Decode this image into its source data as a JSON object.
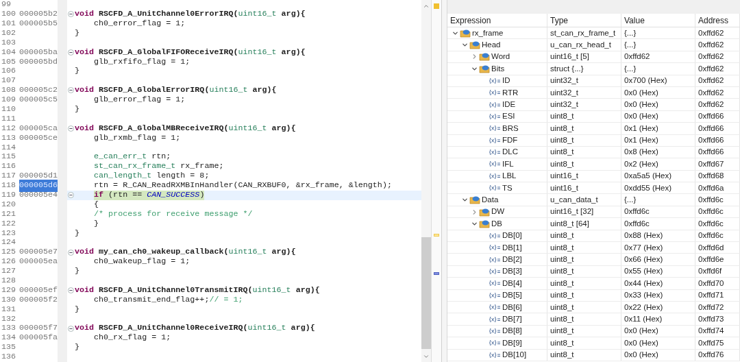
{
  "editor": {
    "lines": [
      {
        "number": "99",
        "fold": false,
        "current": false
      },
      {
        "number": "100",
        "address": "000005b2",
        "fold": true,
        "current": false,
        "address_selected": false,
        "tokens": [
          {
            "kind": "keyword",
            "text": "void"
          },
          {
            "kind": "decl",
            "text": " RSCFD_A_UnitChannel0ErrorIRQ("
          },
          {
            "kind": "type",
            "text": "uint16_t"
          },
          {
            "kind": "decl",
            "text": " arg){"
          }
        ]
      },
      {
        "number": "101",
        "address": "000005b5",
        "fold": false,
        "current": false,
        "address_selected": false,
        "tokens": [
          {
            "kind": "plain",
            "text": "    ch0_error_flag = 1;"
          }
        ]
      },
      {
        "number": "102",
        "fold": false,
        "current": false,
        "tokens": [
          {
            "kind": "plain",
            "text": "}"
          }
        ]
      },
      {
        "number": "103",
        "fold": false,
        "current": false
      },
      {
        "number": "104",
        "address": "000005ba",
        "fold": true,
        "current": false,
        "address_selected": false,
        "tokens": [
          {
            "kind": "keyword",
            "text": "void"
          },
          {
            "kind": "decl",
            "text": " RSCFD_A_GlobalFIFOReceiveIRQ("
          },
          {
            "kind": "type",
            "text": "uint16_t"
          },
          {
            "kind": "decl",
            "text": " arg){"
          }
        ]
      },
      {
        "number": "105",
        "address": "000005bd",
        "fold": false,
        "current": false,
        "address_selected": false,
        "tokens": [
          {
            "kind": "plain",
            "text": "    glb_rxfifo_flag = 1;"
          }
        ]
      },
      {
        "number": "106",
        "fold": false,
        "current": false,
        "tokens": [
          {
            "kind": "plain",
            "text": "}"
          }
        ]
      },
      {
        "number": "107",
        "fold": false,
        "current": false
      },
      {
        "number": "108",
        "address": "000005c2",
        "fold": true,
        "current": false,
        "address_selected": false,
        "tokens": [
          {
            "kind": "keyword",
            "text": "void"
          },
          {
            "kind": "decl",
            "text": " RSCFD_A_GlobalErrorIRQ("
          },
          {
            "kind": "type",
            "text": "uint16_t"
          },
          {
            "kind": "decl",
            "text": " arg){"
          }
        ]
      },
      {
        "number": "109",
        "address": "000005c5",
        "fold": false,
        "current": false,
        "address_selected": false,
        "tokens": [
          {
            "kind": "plain",
            "text": "    glb_error_flag = 1;"
          }
        ]
      },
      {
        "number": "110",
        "fold": false,
        "current": false,
        "tokens": [
          {
            "kind": "plain",
            "text": "}"
          }
        ]
      },
      {
        "number": "111",
        "fold": false,
        "current": false
      },
      {
        "number": "112",
        "address": "000005ca",
        "fold": true,
        "current": false,
        "address_selected": false,
        "tokens": [
          {
            "kind": "keyword",
            "text": "void"
          },
          {
            "kind": "decl",
            "text": " RSCFD_A_GlobalMBReceiveIRQ("
          },
          {
            "kind": "type",
            "text": "uint16_t"
          },
          {
            "kind": "decl",
            "text": " arg){"
          }
        ]
      },
      {
        "number": "113",
        "address": "000005ce",
        "fold": false,
        "current": false,
        "address_selected": false,
        "tokens": [
          {
            "kind": "plain",
            "text": "    glb_rxmb_flag = 1;"
          }
        ]
      },
      {
        "number": "114",
        "fold": false,
        "current": false
      },
      {
        "number": "115",
        "fold": false,
        "current": false,
        "tokens": [
          {
            "kind": "type",
            "text": "    e_can_err_t"
          },
          {
            "kind": "plain",
            "text": " rtn;"
          }
        ]
      },
      {
        "number": "116",
        "fold": false,
        "current": false,
        "tokens": [
          {
            "kind": "type",
            "text": "    st_can_rx_frame_t"
          },
          {
            "kind": "plain",
            "text": " rx_frame;"
          }
        ]
      },
      {
        "number": "117",
        "address": "000005d1",
        "fold": false,
        "current": false,
        "address_selected": false,
        "tokens": [
          {
            "kind": "type",
            "text": "    can_length_t"
          },
          {
            "kind": "plain",
            "text": " length = 8;"
          }
        ]
      },
      {
        "number": "118",
        "address": "000005d6",
        "fold": false,
        "current": false,
        "address_selected": true,
        "tokens": [
          {
            "kind": "plain",
            "text": "    rtn = R_CAN_ReadRXMBInHandler(CAN_RXBUF0, &rx_frame, &length);"
          }
        ]
      },
      {
        "number": "119",
        "address": "000005e4",
        "fold": true,
        "current": true,
        "address_selected": false,
        "tokens": [
          {
            "kind": "keyword",
            "text": "    if"
          },
          {
            "kind": "plain",
            "text": " (rtn == "
          },
          {
            "kind": "constant",
            "text": "CAN_SUCCESS"
          },
          {
            "kind": "plain",
            "text": ")"
          }
        ]
      },
      {
        "number": "120",
        "fold": false,
        "current": false,
        "tokens": [
          {
            "kind": "plain",
            "text": "    {"
          }
        ]
      },
      {
        "number": "121",
        "fold": false,
        "current": false,
        "tokens": [
          {
            "kind": "comment",
            "text": "    /* process for receive message */"
          }
        ]
      },
      {
        "number": "122",
        "fold": false,
        "current": false,
        "tokens": [
          {
            "kind": "plain",
            "text": "    }"
          }
        ]
      },
      {
        "number": "123",
        "fold": false,
        "current": false,
        "tokens": [
          {
            "kind": "plain",
            "text": "}"
          }
        ]
      },
      {
        "number": "124",
        "fold": false,
        "current": false
      },
      {
        "number": "125",
        "address": "000005e7",
        "fold": true,
        "current": false,
        "address_selected": false,
        "tokens": [
          {
            "kind": "keyword",
            "text": "void"
          },
          {
            "kind": "decl",
            "text": " my_can_ch0_wakeup_callback("
          },
          {
            "kind": "type",
            "text": "uint16_t"
          },
          {
            "kind": "decl",
            "text": " arg){"
          }
        ]
      },
      {
        "number": "126",
        "address": "000005ea",
        "fold": false,
        "current": false,
        "address_selected": false,
        "tokens": [
          {
            "kind": "plain",
            "text": "    ch0_wakeup_flag = 1;"
          }
        ]
      },
      {
        "number": "127",
        "fold": false,
        "current": false,
        "tokens": [
          {
            "kind": "plain",
            "text": "}"
          }
        ]
      },
      {
        "number": "128",
        "fold": false,
        "current": false
      },
      {
        "number": "129",
        "address": "000005ef",
        "fold": true,
        "current": false,
        "address_selected": false,
        "tokens": [
          {
            "kind": "keyword",
            "text": "void"
          },
          {
            "kind": "decl",
            "text": " RSCFD_A_UnitChannel0TransmitIRQ("
          },
          {
            "kind": "type",
            "text": "uint16_t"
          },
          {
            "kind": "decl",
            "text": " arg){"
          }
        ]
      },
      {
        "number": "130",
        "address": "000005f2",
        "fold": false,
        "current": false,
        "address_selected": false,
        "tokens": [
          {
            "kind": "plain",
            "text": "    ch0_transmit_end_flag++;"
          },
          {
            "kind": "comment",
            "text": "// = 1;"
          }
        ]
      },
      {
        "number": "131",
        "fold": false,
        "current": false,
        "tokens": [
          {
            "kind": "plain",
            "text": "}"
          }
        ]
      },
      {
        "number": "132",
        "fold": false,
        "current": false
      },
      {
        "number": "133",
        "address": "000005f7",
        "fold": true,
        "current": false,
        "address_selected": false,
        "tokens": [
          {
            "kind": "keyword",
            "text": "void"
          },
          {
            "kind": "decl",
            "text": " RSCFD_A_UnitChannel0ReceiveIRQ("
          },
          {
            "kind": "type",
            "text": "uint16_t"
          },
          {
            "kind": "decl",
            "text": " arg){"
          }
        ]
      },
      {
        "number": "134",
        "address": "000005fa",
        "fold": false,
        "current": false,
        "address_selected": false,
        "tokens": [
          {
            "kind": "plain",
            "text": "    ch0_rx_flag = 1;"
          }
        ]
      },
      {
        "number": "135",
        "fold": false,
        "current": false,
        "tokens": [
          {
            "kind": "plain",
            "text": "}"
          }
        ]
      },
      {
        "number": "136",
        "fold": false,
        "current": false
      }
    ]
  },
  "watch": {
    "columns": [
      "Expression",
      "Type",
      "Value",
      "Address"
    ],
    "rows": [
      {
        "kind": "struct",
        "expanded": true,
        "name": "rx_frame",
        "type": "st_can_rx_frame_t",
        "value": "{...}",
        "address": "0xffd62",
        "children": [
          {
            "kind": "struct",
            "expanded": true,
            "name": "Head",
            "type": "u_can_rx_head_t",
            "value": "{...}",
            "address": "0xffd62",
            "children": [
              {
                "kind": "struct",
                "expanded": false,
                "name": "Word",
                "type": "uint16_t [5]",
                "value": "0xffd62",
                "address": "0xffd62"
              },
              {
                "kind": "struct",
                "expanded": true,
                "name": "Bits",
                "type": "struct {...}",
                "value": "{...}",
                "address": "0xffd62",
                "children": [
                  {
                    "kind": "variable",
                    "name": "ID",
                    "type": "uint32_t",
                    "value": "0x700 (Hex)",
                    "address": "0xffd62"
                  },
                  {
                    "kind": "variable",
                    "name": "RTR",
                    "type": "uint32_t",
                    "value": "0x0 (Hex)",
                    "address": "0xffd62"
                  },
                  {
                    "kind": "variable",
                    "name": "IDE",
                    "type": "uint32_t",
                    "value": "0x0 (Hex)",
                    "address": "0xffd62"
                  },
                  {
                    "kind": "variable",
                    "name": "ESI",
                    "type": "uint8_t",
                    "value": "0x0 (Hex)",
                    "address": "0xffd66"
                  },
                  {
                    "kind": "variable",
                    "name": "BRS",
                    "type": "uint8_t",
                    "value": "0x1 (Hex)",
                    "address": "0xffd66"
                  },
                  {
                    "kind": "variable",
                    "name": "FDF",
                    "type": "uint8_t",
                    "value": "0x1 (Hex)",
                    "address": "0xffd66"
                  },
                  {
                    "kind": "variable",
                    "name": "DLC",
                    "type": "uint8_t",
                    "value": "0x8 (Hex)",
                    "address": "0xffd66"
                  },
                  {
                    "kind": "variable",
                    "name": "IFL",
                    "type": "uint8_t",
                    "value": "0x2 (Hex)",
                    "address": "0xffd67"
                  },
                  {
                    "kind": "variable",
                    "name": "LBL",
                    "type": "uint16_t",
                    "value": "0xa5a5 (Hex)",
                    "address": "0xffd68"
                  },
                  {
                    "kind": "variable",
                    "name": "TS",
                    "type": "uint16_t",
                    "value": "0xdd55 (Hex)",
                    "address": "0xffd6a"
                  }
                ]
              }
            ]
          },
          {
            "kind": "struct",
            "expanded": true,
            "name": "Data",
            "type": "u_can_data_t",
            "value": "{...}",
            "address": "0xffd6c",
            "children": [
              {
                "kind": "struct",
                "expanded": false,
                "name": "DW",
                "type": "uint16_t [32]",
                "value": "0xffd6c",
                "address": "0xffd6c"
              },
              {
                "kind": "struct",
                "expanded": true,
                "name": "DB",
                "type": "uint8_t [64]",
                "value": "0xffd6c",
                "address": "0xffd6c",
                "children": [
                  {
                    "kind": "variable",
                    "name": "DB[0]",
                    "type": "uint8_t",
                    "value": "0x88 (Hex)",
                    "address": "0xffd6c"
                  },
                  {
                    "kind": "variable",
                    "name": "DB[1]",
                    "type": "uint8_t",
                    "value": "0x77 (Hex)",
                    "address": "0xffd6d"
                  },
                  {
                    "kind": "variable",
                    "name": "DB[2]",
                    "type": "uint8_t",
                    "value": "0x66 (Hex)",
                    "address": "0xffd6e"
                  },
                  {
                    "kind": "variable",
                    "name": "DB[3]",
                    "type": "uint8_t",
                    "value": "0x55 (Hex)",
                    "address": "0xffd6f"
                  },
                  {
                    "kind": "variable",
                    "name": "DB[4]",
                    "type": "uint8_t",
                    "value": "0x44 (Hex)",
                    "address": "0xffd70"
                  },
                  {
                    "kind": "variable",
                    "name": "DB[5]",
                    "type": "uint8_t",
                    "value": "0x33 (Hex)",
                    "address": "0xffd71"
                  },
                  {
                    "kind": "variable",
                    "name": "DB[6]",
                    "type": "uint8_t",
                    "value": "0x22 (Hex)",
                    "address": "0xffd72"
                  },
                  {
                    "kind": "variable",
                    "name": "DB[7]",
                    "type": "uint8_t",
                    "value": "0x11 (Hex)",
                    "address": "0xffd73"
                  },
                  {
                    "kind": "variable",
                    "name": "DB[8]",
                    "type": "uint8_t",
                    "value": "0x0 (Hex)",
                    "address": "0xffd74"
                  },
                  {
                    "kind": "variable",
                    "name": "DB[9]",
                    "type": "uint8_t",
                    "value": "0x0 (Hex)",
                    "address": "0xffd75"
                  },
                  {
                    "kind": "variable",
                    "name": "DB[10]",
                    "type": "uint8_t",
                    "value": "0x0 (Hex)",
                    "address": "0xffd76"
                  }
                ]
              }
            ]
          }
        ]
      }
    ]
  }
}
